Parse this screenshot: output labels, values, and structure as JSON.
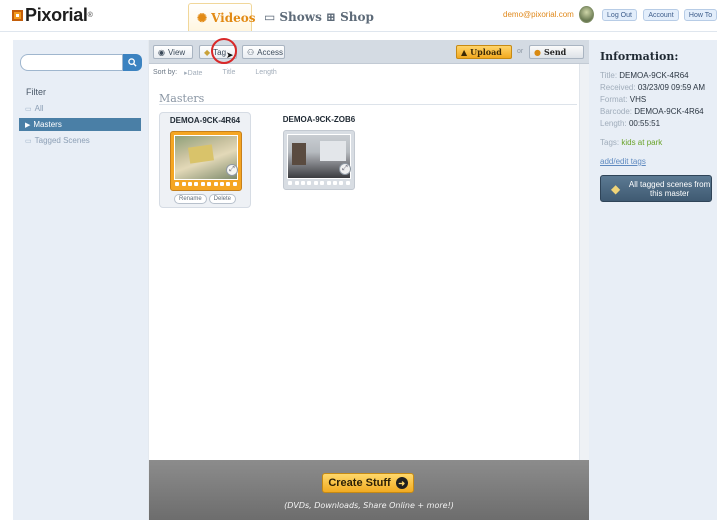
{
  "header": {
    "logo": "Pixorial",
    "logo_mark": "®",
    "tabs": [
      {
        "label": "Videos",
        "icon": "film-reel-icon"
      },
      {
        "label": "Shows",
        "icon": "film-strip-icon"
      },
      {
        "label": "Shop",
        "icon": "shopping-cart-icon"
      }
    ],
    "user_email": "demo@pixorial.com",
    "buttons": {
      "logout": "Log Out",
      "account": "Account",
      "howto": "How To"
    }
  },
  "sidebar": {
    "search": {
      "placeholder": ""
    },
    "filter_label": "Filter",
    "items": [
      {
        "label": "All"
      },
      {
        "label": "Masters"
      },
      {
        "label": "Tagged Scenes"
      }
    ]
  },
  "toolbar": {
    "view": "View",
    "tag": "Tag",
    "access": "Access",
    "upload": "Upload",
    "or": "or",
    "send": "Send"
  },
  "sort": {
    "label": "Sort by:",
    "options": [
      "Date",
      "Title",
      "Length"
    ]
  },
  "section_title": "Masters",
  "videos": [
    {
      "title": "DEMOA-9CK-4R64",
      "actions": [
        "Rename",
        "Delete"
      ]
    },
    {
      "title": "DEMOA-9CK-ZOB6"
    }
  ],
  "bottom": {
    "create_label": "Create Stuff",
    "subtitle": "(DVDs, Downloads, Share Online + more!)"
  },
  "info": {
    "title": "Information:",
    "rows": [
      {
        "key": "Title:",
        "value": "DEMOA-9CK-4R64"
      },
      {
        "key": "Received:",
        "value": "03/23/09 09:59 AM"
      },
      {
        "key": "Format:",
        "value": "VHS"
      },
      {
        "key": "Barcode:",
        "value": "DEMOA-9CK-4R64"
      },
      {
        "key": "Length:",
        "value": "00:55:51"
      }
    ],
    "tags_key": "Tags:",
    "tags_value": "kids at park",
    "edit_tags": "add/edit tags",
    "tagged_button": "All tagged scenes from this master"
  },
  "colors": {
    "accent": "#f39a1c",
    "selected_row": "#4a7fa6",
    "panel_bg": "#e8eef6"
  }
}
